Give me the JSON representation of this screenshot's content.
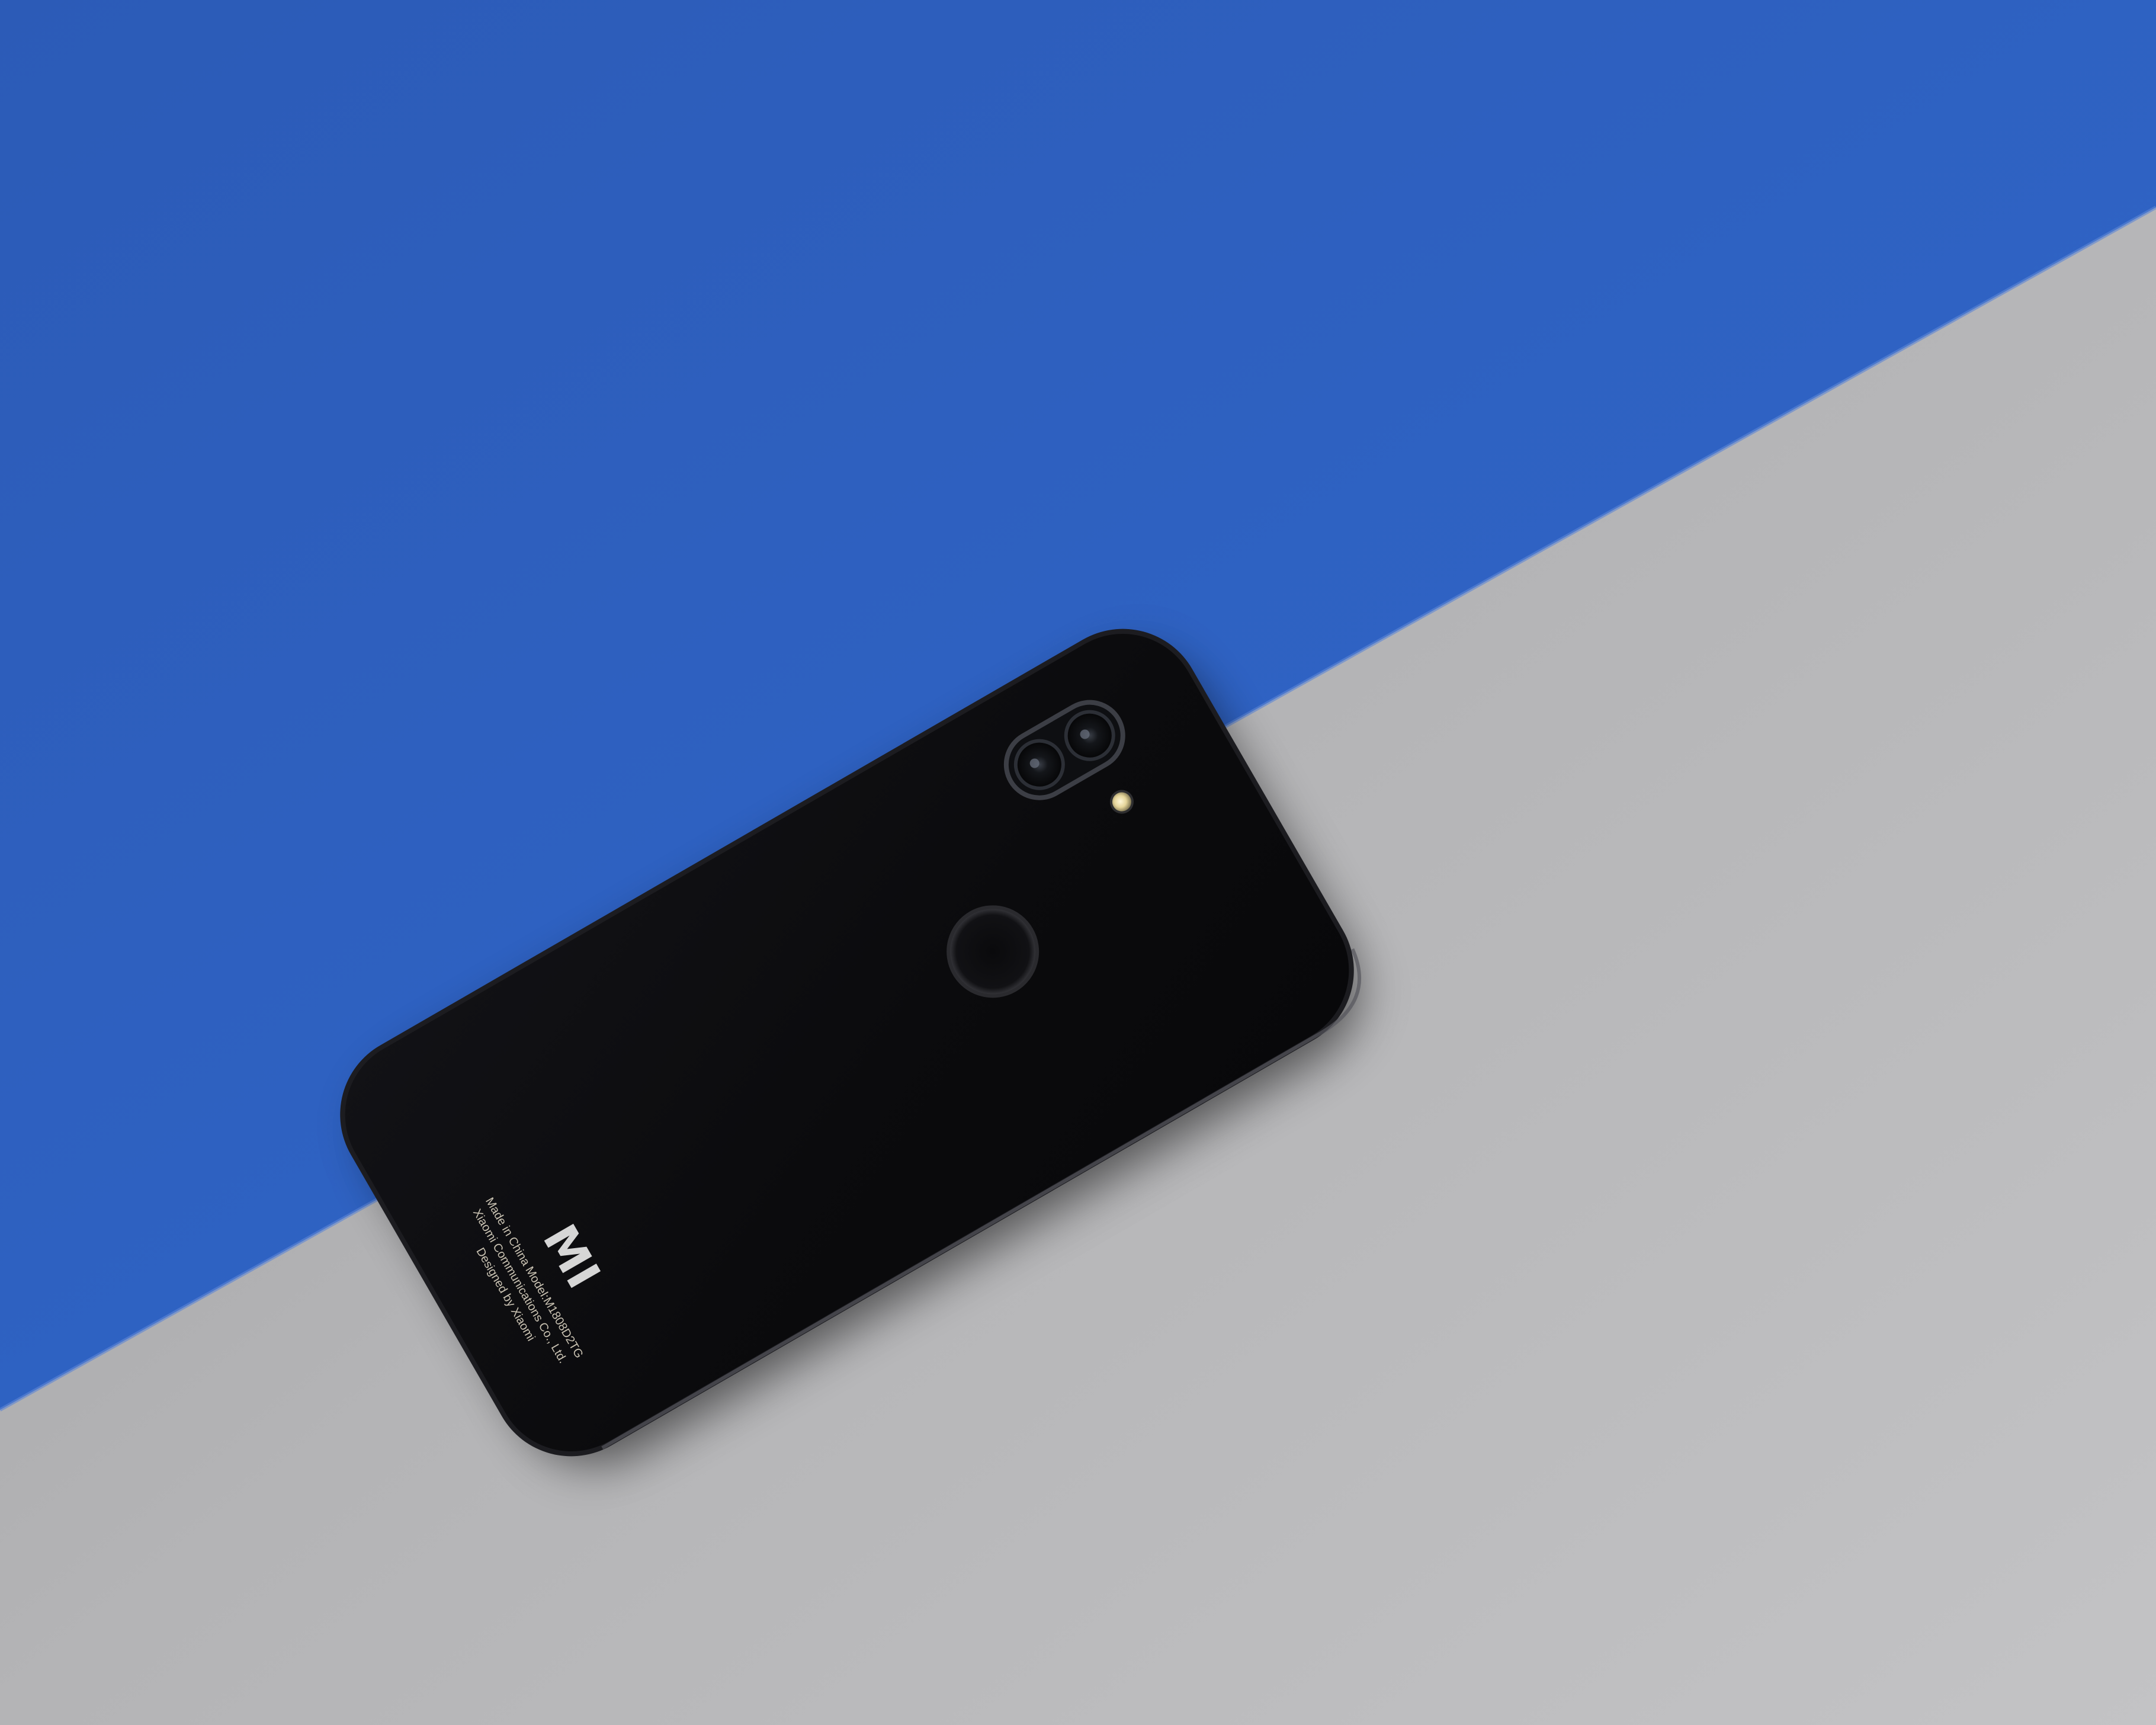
{
  "scene": {
    "subject": "smartphone back panel",
    "background_colors": {
      "blue_paper": "#2e5fbe",
      "grey_paper": "#bbbbbd"
    },
    "phone_colors": {
      "body": "#0b0b0d",
      "edge": "#1e1e22",
      "highlight": "#4a4a52"
    }
  },
  "phone": {
    "logo_text": "MI",
    "back_text": [
      "Made in China Model:M1808D2TG",
      "Xiaomi Communications Co., Ltd.",
      "Designed by Xiaomi"
    ]
  },
  "icons": [
    "camera-lens-icon",
    "flash-icon",
    "fingerprint-sensor-icon"
  ]
}
